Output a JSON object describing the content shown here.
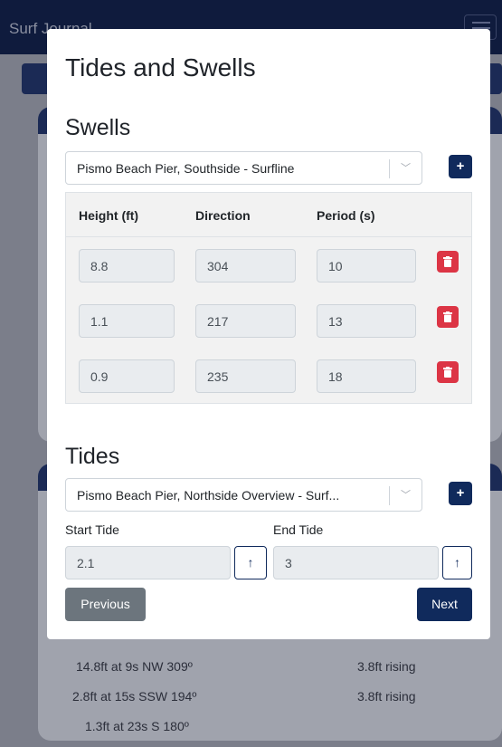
{
  "app": {
    "title": "Surf Journal"
  },
  "modal": {
    "title": "Tides and Swells",
    "swells": {
      "heading": "Swells",
      "selected_source": "Pismo Beach Pier, Southside - Surfline",
      "add_label": "+",
      "columns": [
        "Height (ft)",
        "Direction",
        "Period (s)"
      ],
      "rows": [
        {
          "height": "8.8",
          "direction": "304",
          "period": "10"
        },
        {
          "height": "1.1",
          "direction": "217",
          "period": "13"
        },
        {
          "height": "0.9",
          "direction": "235",
          "period": "18"
        }
      ]
    },
    "tides": {
      "heading": "Tides",
      "selected_source": "Pismo Beach Pier, Northside Overview - Surf...",
      "add_label": "+",
      "start_label": "Start Tide",
      "end_label": "End Tide",
      "start_value": "2.1",
      "end_value": "3",
      "start_arrow": "↑",
      "end_arrow": "↑"
    },
    "buttons": {
      "previous": "Previous",
      "next": "Next"
    }
  },
  "background": {
    "rows": [
      {
        "swell": "14.8ft at 9s NW 309º",
        "tide": "3.8ft rising"
      },
      {
        "swell": "2.8ft at 15s SSW 194º",
        "tide": "3.8ft rising"
      },
      {
        "swell": "1.3ft at 23s S 180º",
        "tide": ""
      }
    ]
  },
  "colors": {
    "primary": "#102a5c",
    "danger": "#dc3545",
    "secondary": "#6c757d",
    "input_disabled": "#e9ecef"
  }
}
